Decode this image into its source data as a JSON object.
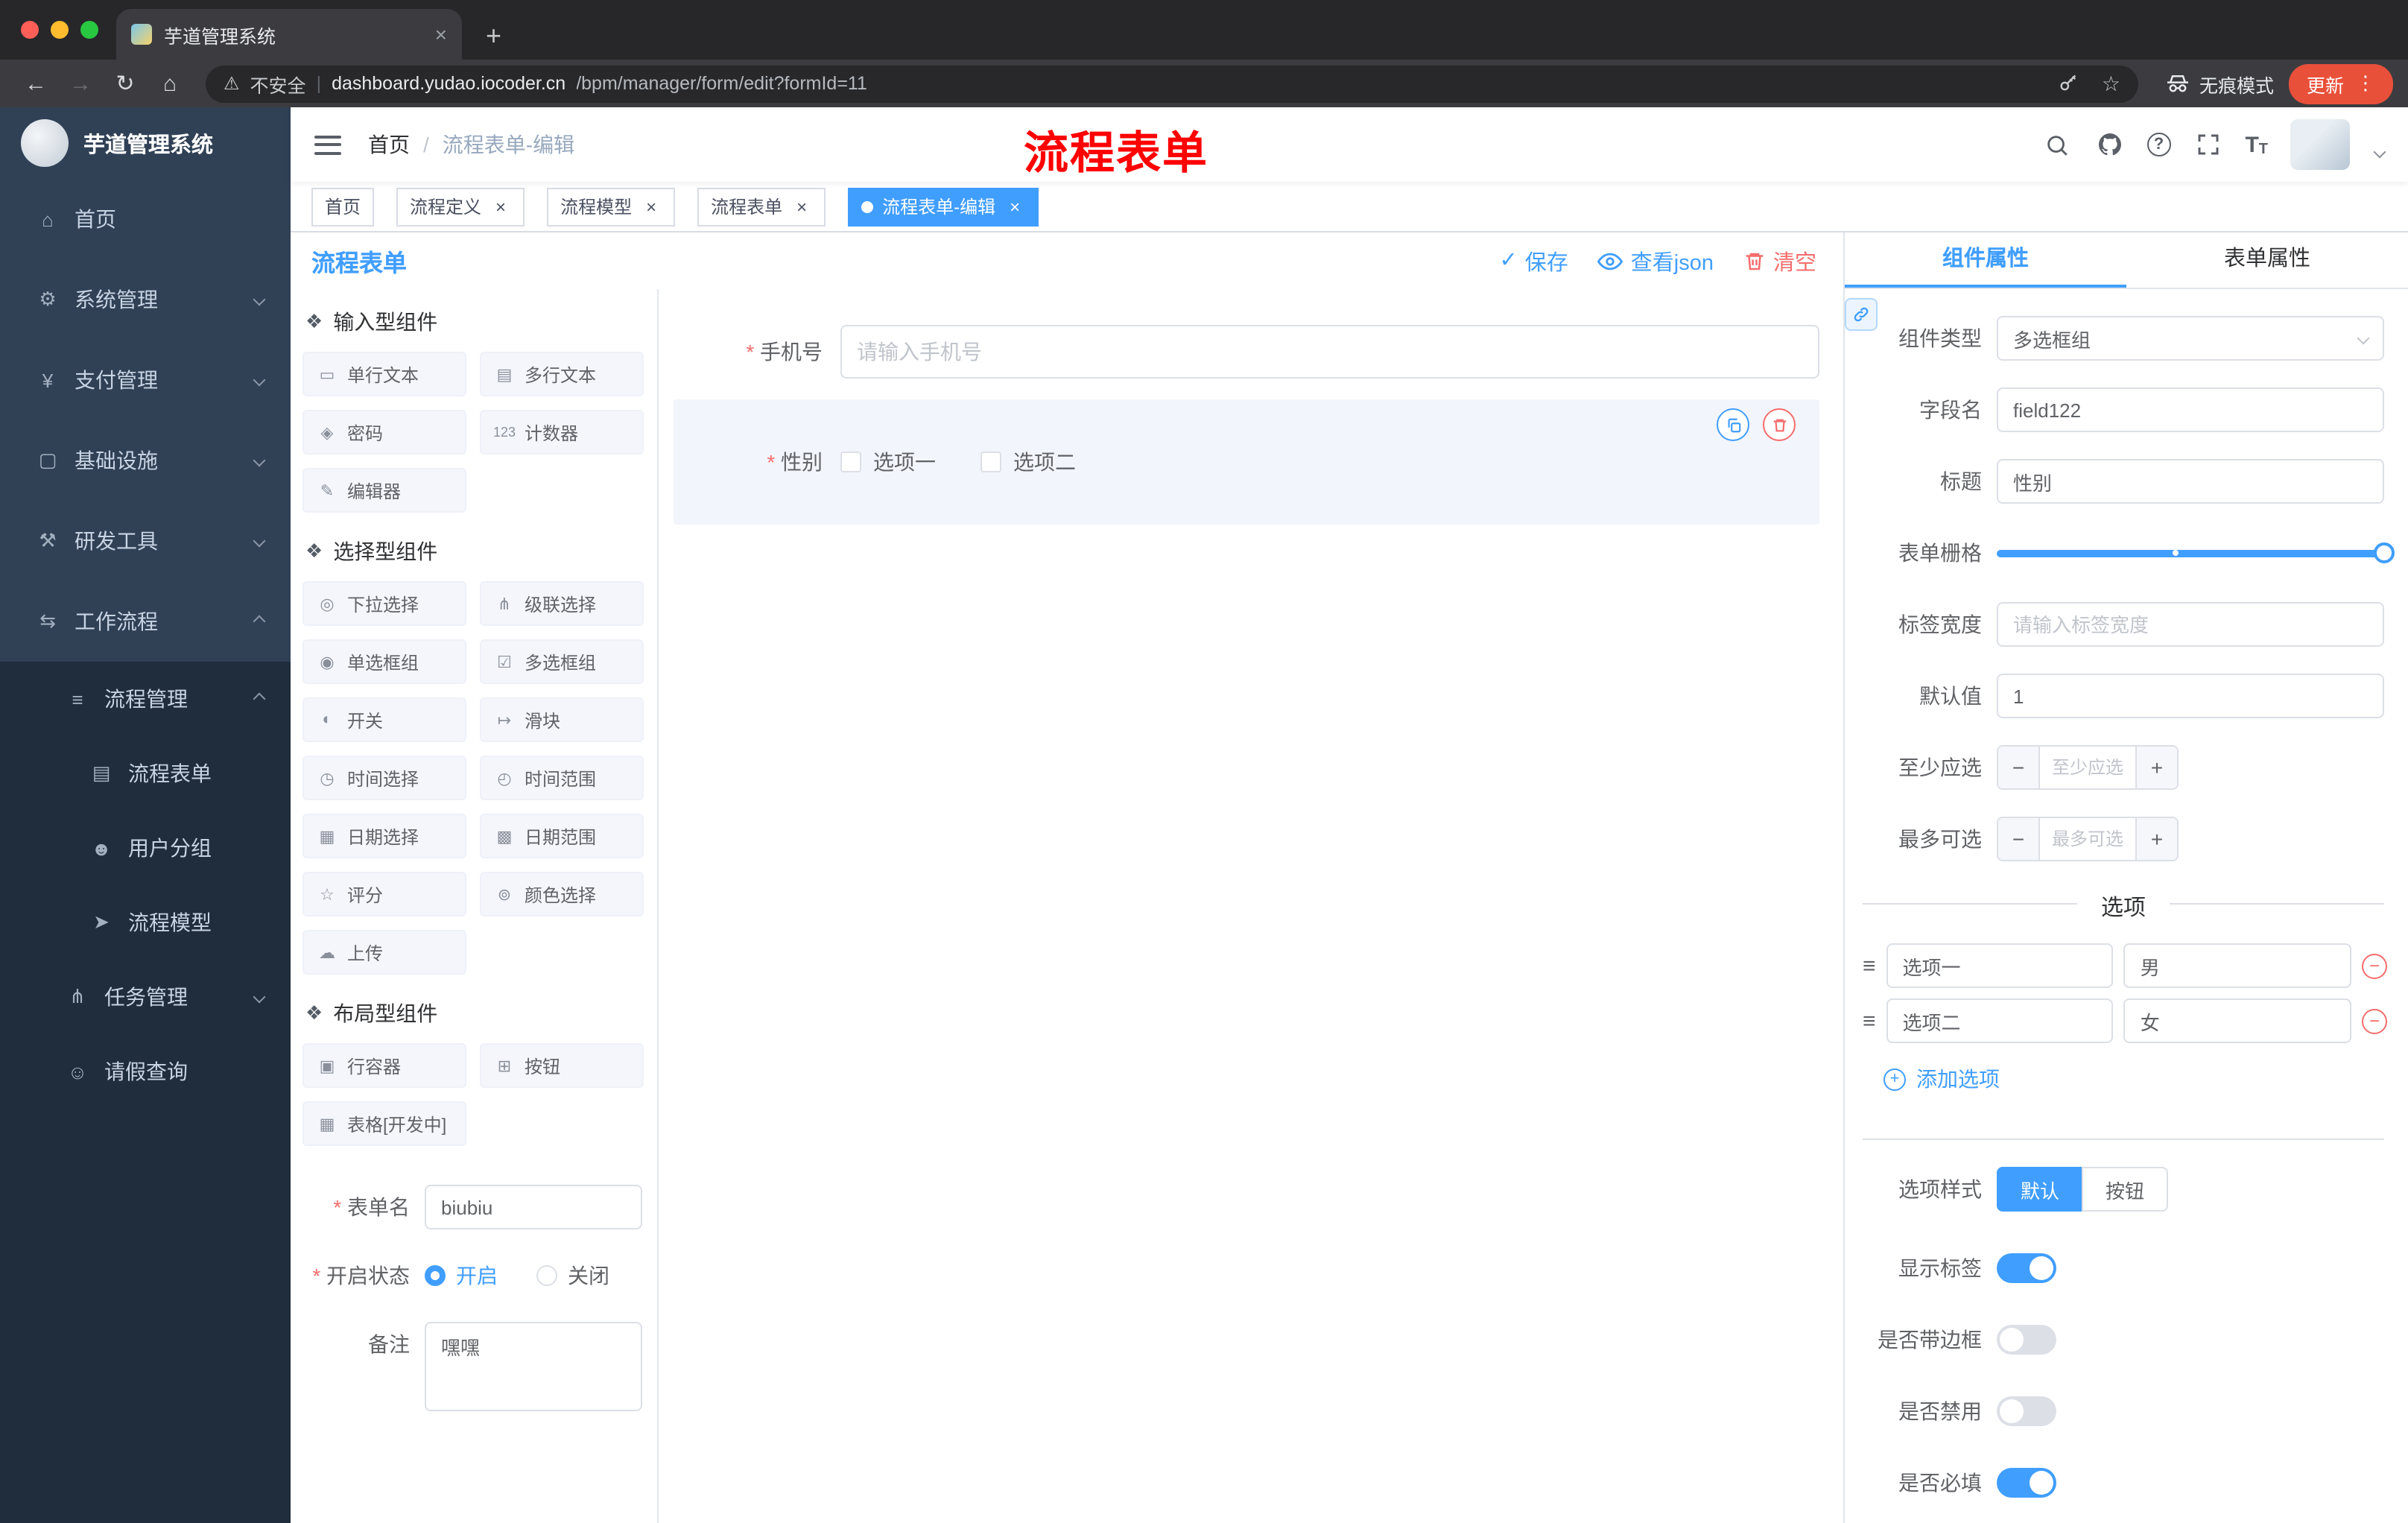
{
  "theme": {
    "accent": "#409EFF",
    "danger": "#F56C6C",
    "sidebar_bg": "#304156",
    "submenu_bg": "#1f2d3d",
    "annotation_red": "#fe0000",
    "update_pill": "#e8503a"
  },
  "glyphs": {
    "back": "←",
    "forward": "→",
    "reload": "↻",
    "home": "⌂",
    "warning": "⚠",
    "star": "☆",
    "dots": "⋮",
    "plus": "+",
    "close": "×",
    "check": "✓",
    "help": "?",
    "fontsize_large": "T",
    "fontsize_small": "T",
    "minus": "−",
    "drag": "≡",
    "yen": "¥"
  },
  "browser": {
    "tab_title": "芋道管理系统",
    "security_label": "不安全",
    "url_domain": "dashboard.yudao.iocoder.cn",
    "url_path": "/bpm/manager/form/edit?formId=11",
    "incognito_label": "无痕模式",
    "update_label": "更新"
  },
  "sidebar": {
    "logo_title": "芋道管理系统",
    "items": [
      {
        "icon": "⌂",
        "label": "首页"
      },
      {
        "icon": "⚙",
        "label": "系统管理"
      },
      {
        "icon": "¥",
        "label": "支付管理"
      },
      {
        "icon": "▢",
        "label": "基础设施"
      },
      {
        "icon": "⚒",
        "label": "研发工具"
      },
      {
        "icon": "⇆",
        "label": "工作流程"
      },
      {
        "icon": "≡",
        "label": "流程管理"
      },
      {
        "icon": "▤",
        "label": "流程表单"
      },
      {
        "icon": "☻",
        "label": "用户分组"
      },
      {
        "icon": "➤",
        "label": "流程模型"
      },
      {
        "icon": "⋔",
        "label": "任务管理"
      },
      {
        "icon": "☺",
        "label": "请假查询"
      }
    ]
  },
  "navbar": {
    "breadcrumb_home": "首页",
    "breadcrumb_separator": "/",
    "breadcrumb_current": "流程表单-编辑",
    "annotation": "流程表单"
  },
  "tags": [
    {
      "label": "首页"
    },
    {
      "label": "流程定义"
    },
    {
      "label": "流程模型"
    },
    {
      "label": "流程表单"
    },
    {
      "label": "流程表单-编辑"
    }
  ],
  "editor": {
    "title": "流程表单",
    "save": "保存",
    "view_json": "查看json",
    "clear": "清空"
  },
  "palette": {
    "sections": [
      {
        "title": "输入型组件",
        "items": [
          {
            "icon": "▭",
            "label": "单行文本"
          },
          {
            "icon": "▤",
            "label": "多行文本"
          },
          {
            "icon": "◈",
            "label": "密码"
          },
          {
            "icon": "123",
            "label": "计数器"
          },
          {
            "icon": "✎",
            "label": "编辑器"
          }
        ]
      },
      {
        "title": "选择型组件",
        "items": [
          {
            "icon": "◎",
            "label": "下拉选择"
          },
          {
            "icon": "⋔",
            "label": "级联选择"
          },
          {
            "icon": "◉",
            "label": "单选框组"
          },
          {
            "icon": "☑",
            "label": "多选框组"
          },
          {
            "icon": "◐",
            "label": "开关"
          },
          {
            "icon": "↦",
            "label": "滑块"
          },
          {
            "icon": "◷",
            "label": "时间选择"
          },
          {
            "icon": "◴",
            "label": "时间范围"
          },
          {
            "icon": "▦",
            "label": "日期选择"
          },
          {
            "icon": "▩",
            "label": "日期范围"
          },
          {
            "icon": "☆",
            "label": "评分"
          },
          {
            "icon": "⊚",
            "label": "颜色选择"
          },
          {
            "icon": "☁",
            "label": "上传"
          }
        ]
      },
      {
        "title": "布局型组件",
        "items": [
          {
            "icon": "▣",
            "label": "行容器"
          },
          {
            "icon": "⊞",
            "label": "按钮"
          },
          {
            "icon": "▦",
            "label": "表格[开发中]"
          }
        ]
      }
    ]
  },
  "form_meta": {
    "name_label": "表单名",
    "name_value": "biubiu",
    "status_label": "开启状态",
    "status_on": "开启",
    "status_off": "关闭",
    "remark_label": "备注",
    "remark_value": "嘿嘿"
  },
  "canvas": {
    "phone_label": "手机号",
    "phone_placeholder": "请输入手机号",
    "gender_label": "性别",
    "gender_option1": "选项一",
    "gender_option2": "选项二"
  },
  "props": {
    "tab_component": "组件属性",
    "tab_form": "表单属性",
    "component_type_label": "组件类型",
    "component_type_value": "多选框组",
    "field_label": "字段名",
    "field_value": "field122",
    "title_label": "标题",
    "title_value": "性别",
    "grid_label": "表单栅格",
    "label_width_label": "标签宽度",
    "label_width_placeholder": "请输入标签宽度",
    "default_label": "默认值",
    "default_value": "1",
    "min_label": "至少应选",
    "min_placeholder": "至少应选",
    "max_label": "最多可选",
    "max_placeholder": "最多可选",
    "options_title": "选项",
    "options": [
      {
        "label": "选项一",
        "value": "男"
      },
      {
        "label": "选项二",
        "value": "女"
      }
    ],
    "add_option": "添加选项",
    "style_label": "选项样式",
    "style_default": "默认",
    "style_button": "按钮",
    "show_label": "显示标签",
    "border_label": "是否带边框",
    "disabled_label": "是否禁用",
    "required_label": "是否必填"
  }
}
